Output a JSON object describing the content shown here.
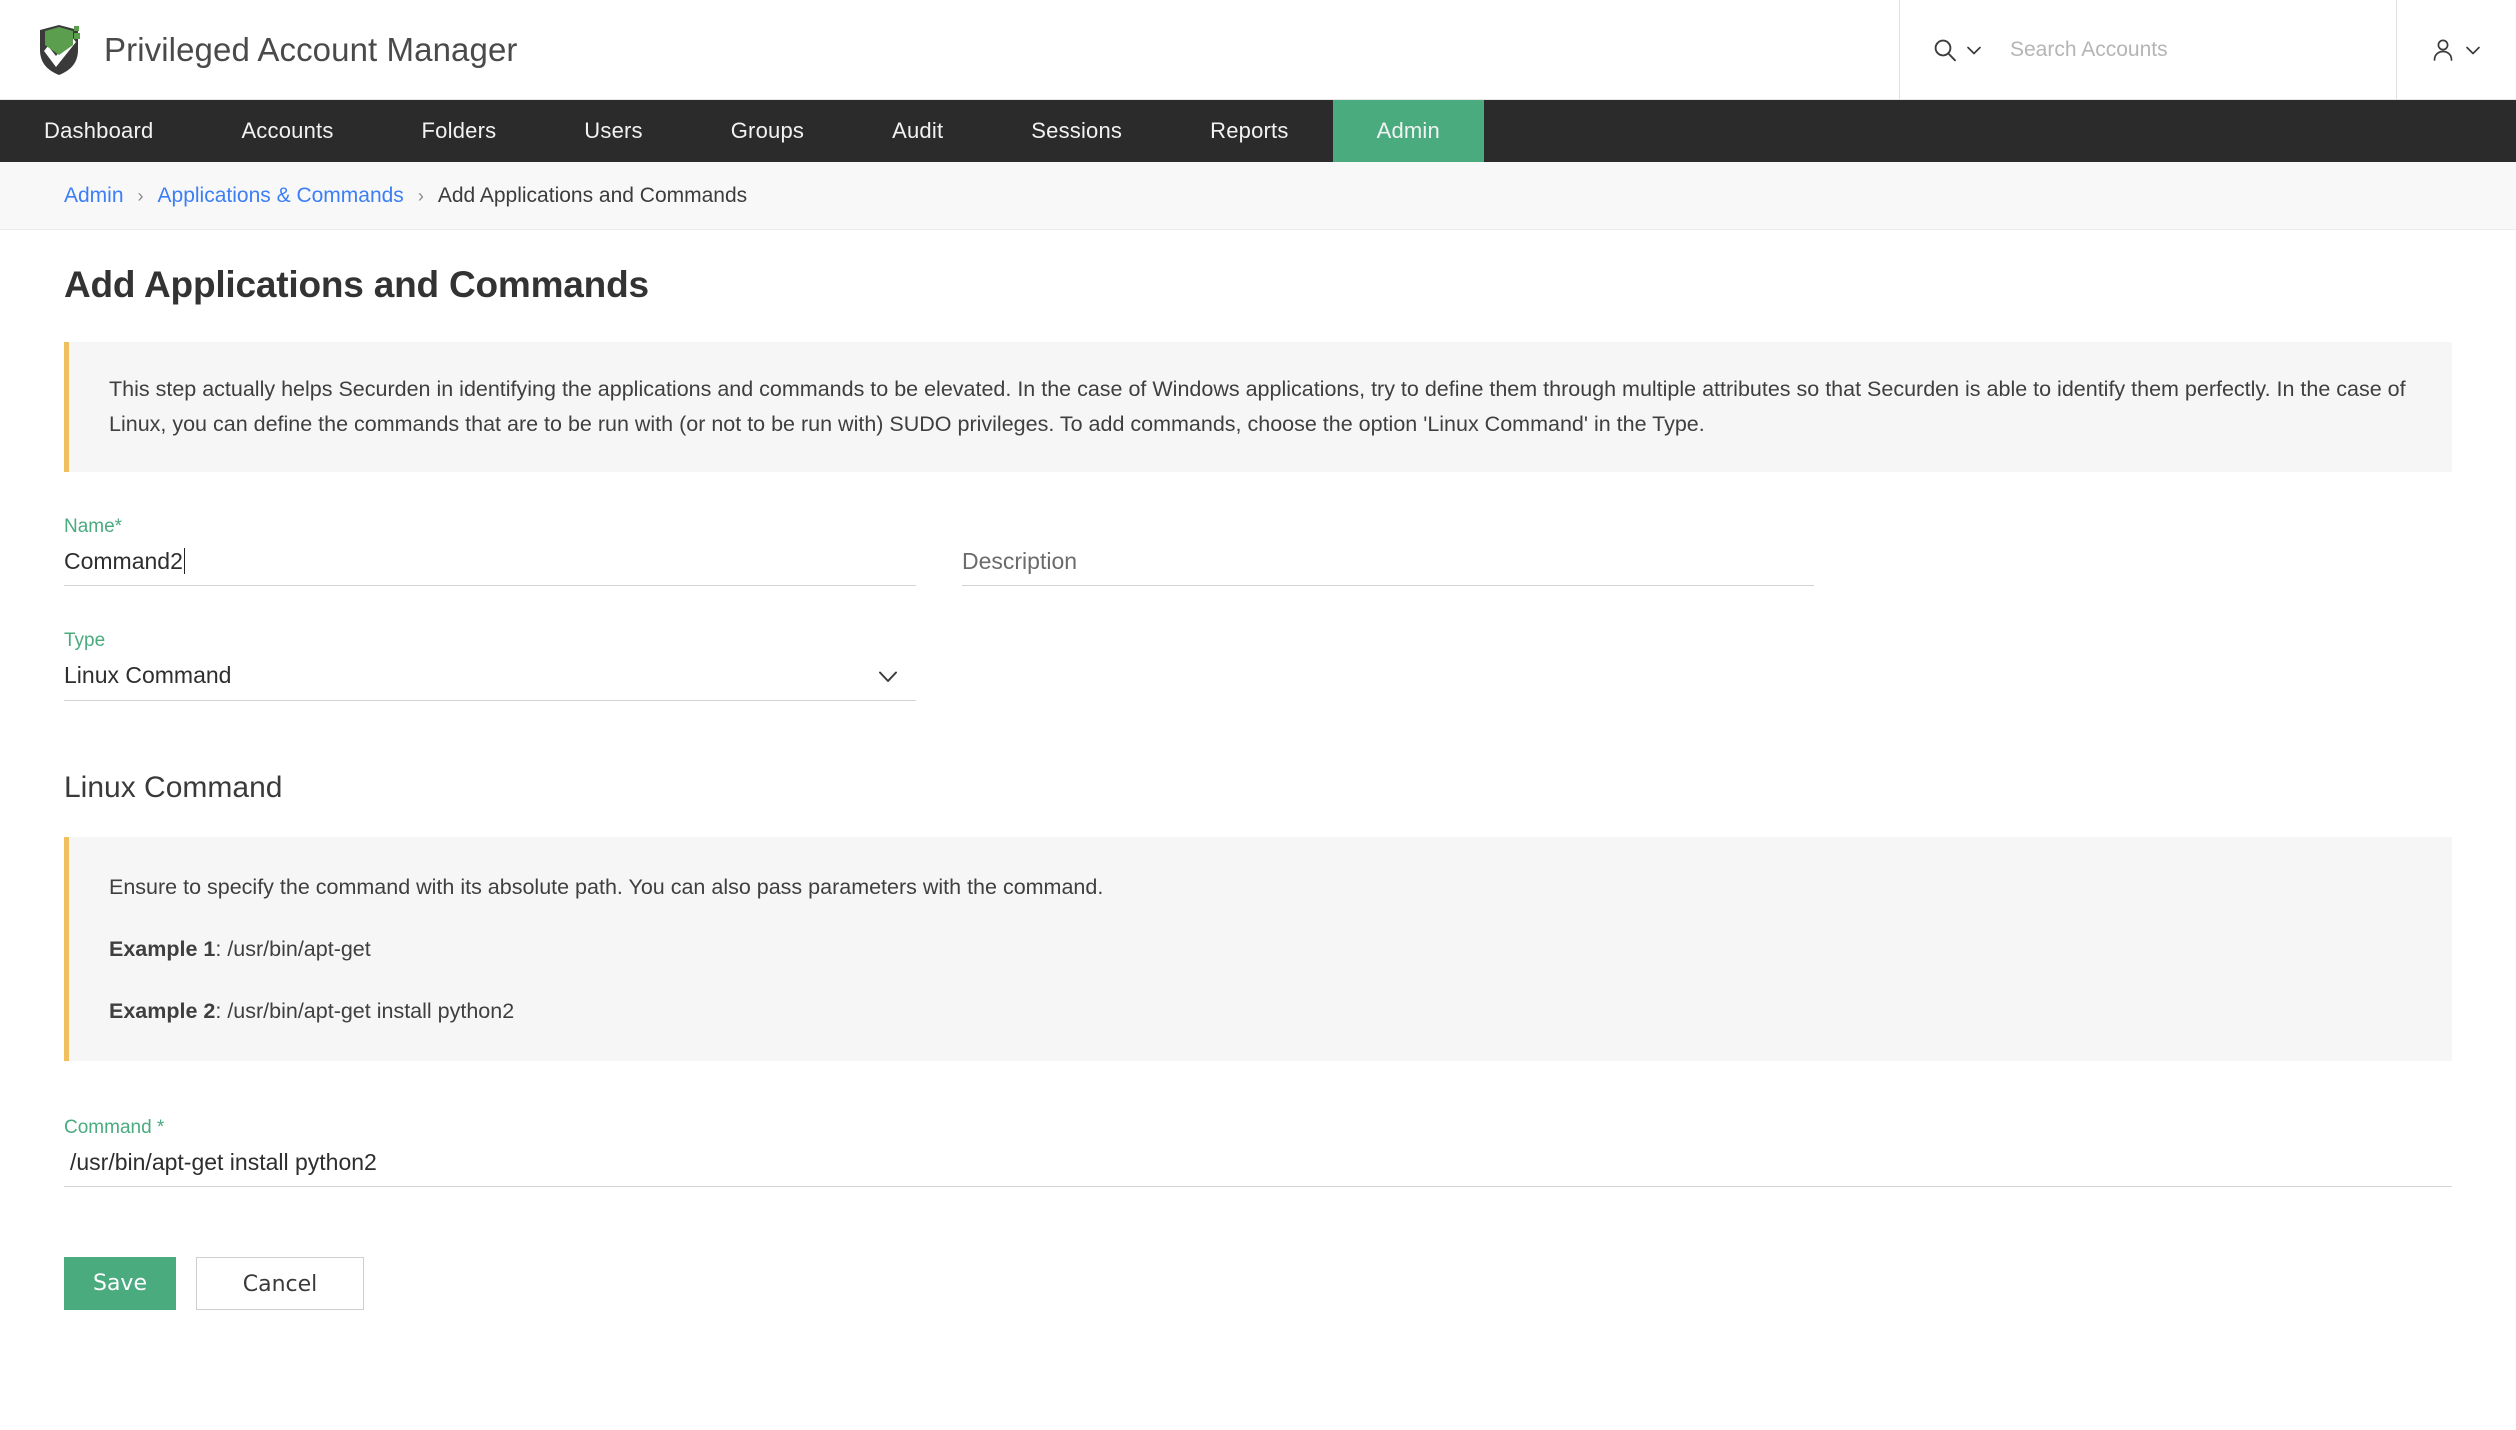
{
  "header": {
    "brand_title": "Privileged Account Manager",
    "logo_icon": "shield-check-logo",
    "search": {
      "icon": "search-icon",
      "dropdown_icon": "chevron-down-icon",
      "placeholder": "Search Accounts",
      "value": ""
    },
    "user_menu": {
      "icon": "user-icon",
      "dropdown_icon": "chevron-down-icon"
    }
  },
  "nav": {
    "items": [
      {
        "label": "Dashboard",
        "active": false
      },
      {
        "label": "Accounts",
        "active": false
      },
      {
        "label": "Folders",
        "active": false
      },
      {
        "label": "Users",
        "active": false
      },
      {
        "label": "Groups",
        "active": false
      },
      {
        "label": "Audit",
        "active": false
      },
      {
        "label": "Sessions",
        "active": false
      },
      {
        "label": "Reports",
        "active": false
      },
      {
        "label": "Admin",
        "active": true
      }
    ],
    "active_color": "#4aab7f",
    "bar_color": "#2b2b2b"
  },
  "breadcrumb": {
    "items": [
      {
        "label": "Admin",
        "link": true
      },
      {
        "label": "Applications & Commands",
        "link": true
      },
      {
        "label": "Add Applications and Commands",
        "link": false
      }
    ],
    "separator": "›",
    "link_color": "#3b7ef5"
  },
  "page": {
    "title": "Add Applications and Commands",
    "notice": "This step actually helps Securden in identifying the applications and commands to be elevated. In the case of Windows applications, try to define them through multiple attributes so that Securden is able to identify them perfectly. In the case of Linux, you can define the commands that are to be run with (or not to be run with) SUDO privileges. To add commands, choose the option 'Linux Command' in the Type.",
    "notice_accent_color": "#f0c060"
  },
  "form": {
    "name": {
      "label": "Name*",
      "value": "Command2",
      "placeholder": "",
      "focused": true
    },
    "description": {
      "label": "",
      "value": "",
      "placeholder": "Description"
    },
    "type": {
      "label": "Type",
      "value": "Linux Command",
      "chevron_icon": "chevron-down-icon",
      "options": [
        "Linux Command"
      ]
    },
    "command": {
      "label": "Command *",
      "value": "/usr/bin/apt-get install python2",
      "placeholder": ""
    },
    "label_color": "#4aab7f"
  },
  "linux_section": {
    "heading": "Linux Command",
    "info_line_1": "Ensure to specify the command with its absolute path. You can also pass parameters with the command.",
    "example_1_label": "Example 1",
    "example_1_value": ": /usr/bin/apt-get",
    "example_2_label": "Example 2",
    "example_2_value": ": /usr/bin/apt-get install python2"
  },
  "actions": {
    "save_label": "Save",
    "cancel_label": "Cancel",
    "save_color": "#4aab7f"
  }
}
